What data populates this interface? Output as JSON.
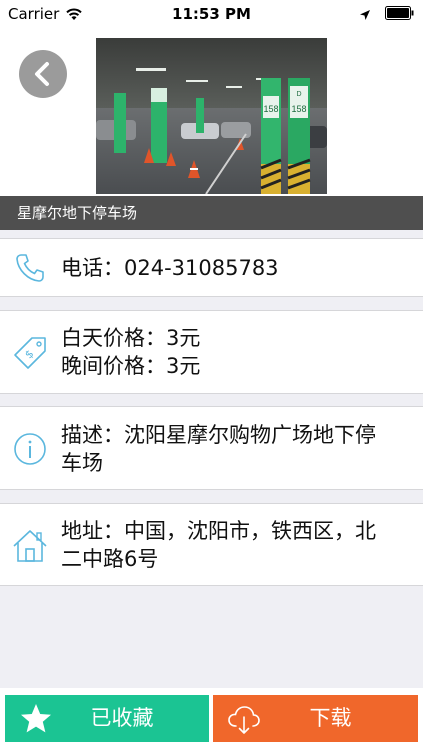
{
  "status_bar": {
    "carrier": "Carrier",
    "time": "11:53 PM"
  },
  "header": {
    "title": "星摩尔地下停车场",
    "photo_pillar_numbers": [
      "158",
      "158"
    ],
    "photo_pillar_letter": "D"
  },
  "details": {
    "phone": "电话：024-31085783",
    "day_price": "白天价格：3元",
    "night_price": "晚间价格：3元",
    "description": "描述：沈阳星摩尔购物广场地下停车场",
    "address": "地址：中国，沈阳市，铁西区，北二中路6号"
  },
  "actions": {
    "favorite_label": "已收藏",
    "download_label": "下载"
  },
  "colors": {
    "favorite_green": "#1bc493",
    "download_orange": "#f0672b",
    "icon_blue": "#5bb7de",
    "title_bar": "#4f4f4f"
  },
  "icons": [
    "wifi-icon",
    "location-arrow-icon",
    "battery-icon",
    "back-chevron-icon",
    "phone-icon",
    "price-tag-icon",
    "info-icon",
    "home-icon",
    "star-icon",
    "cloud-download-icon"
  ]
}
